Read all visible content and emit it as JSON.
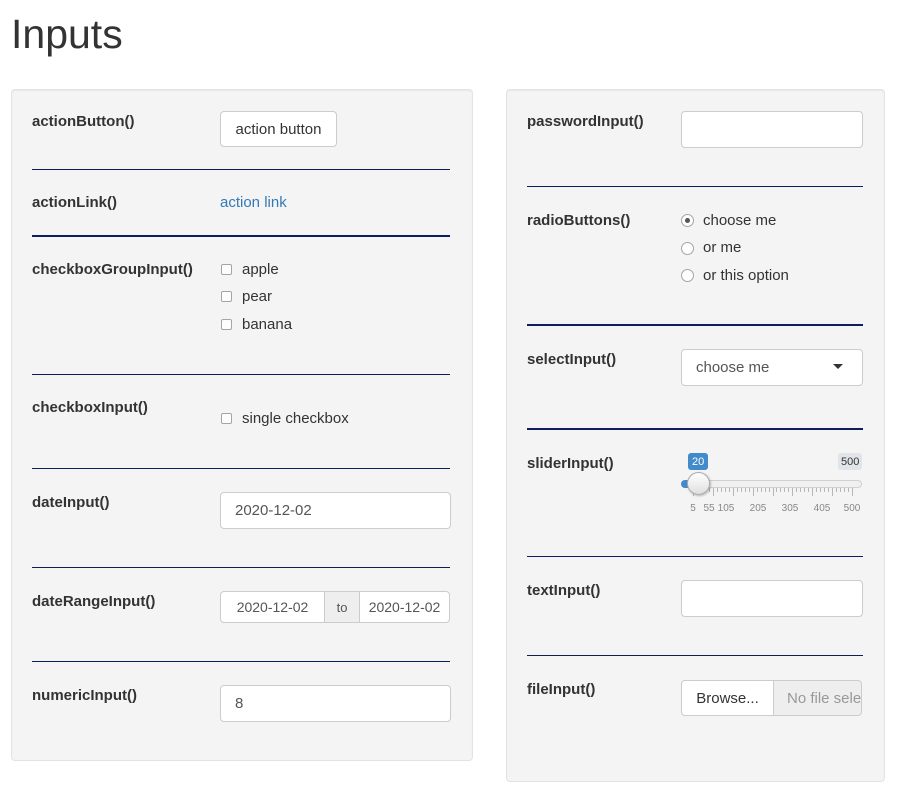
{
  "title": "Inputs",
  "left": {
    "action_button": {
      "label": "actionButton()",
      "button": "action button"
    },
    "action_link": {
      "label": "actionLink()",
      "link": "action link"
    },
    "checkbox_group": {
      "label": "checkboxGroupInput()",
      "options": [
        "apple",
        "pear",
        "banana"
      ]
    },
    "checkbox": {
      "label": "checkboxInput()",
      "option": "single checkbox"
    },
    "date": {
      "label": "dateInput()",
      "value": "2020-12-02"
    },
    "date_range": {
      "label": "dateRangeInput()",
      "start": "2020-12-02",
      "separator": "to",
      "end": "2020-12-02"
    },
    "numeric": {
      "label": "numericInput()",
      "value": "8"
    }
  },
  "right": {
    "password": {
      "label": "passwordInput()",
      "value": ""
    },
    "radio": {
      "label": "radioButtons()",
      "options": [
        "choose me",
        "or me",
        "or this option"
      ],
      "selected": 0
    },
    "select": {
      "label": "selectInput()",
      "value": "choose me"
    },
    "slider": {
      "label": "sliderInput()",
      "min": 5,
      "max": 500,
      "value": 20,
      "value_label": "20",
      "max_label": "500",
      "tick_labels": [
        "5",
        "55",
        "105",
        "205",
        "305",
        "405",
        "500"
      ]
    },
    "text": {
      "label": "textInput()",
      "value": ""
    },
    "file": {
      "label": "fileInput()",
      "button": "Browse...",
      "placeholder": "No file selected"
    }
  }
}
